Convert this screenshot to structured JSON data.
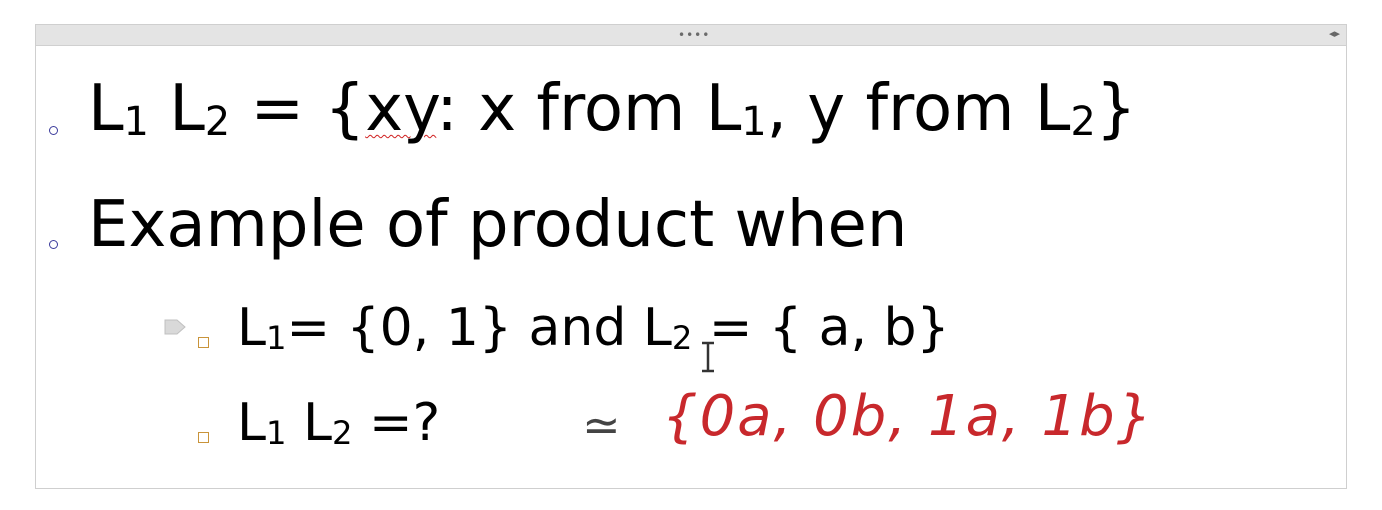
{
  "slide": {
    "grip": "••••",
    "nav": "◂▸",
    "bullets": [
      {
        "level": 1,
        "parts": {
          "a": "L",
          "a_sub": "1",
          "b": " L",
          "b_sub": "2",
          "eq": " = {",
          "xy": "xy",
          "rest": ": x from L",
          "r_sub": "1",
          "rest2": ", y from L",
          "r2_sub": "2",
          "close": "}"
        }
      },
      {
        "level": 1,
        "text": "Example of product when"
      },
      {
        "level": 2,
        "parts": {
          "a": "L",
          "a_sub": "1",
          "mid": "= {0, 1} and L",
          "m_sub": "2",
          "end": " = { a, b}"
        }
      },
      {
        "level": 2,
        "parts": {
          "a": "L",
          "a_sub": "1",
          "b": " L",
          "b_sub": "2",
          "end": " =?"
        }
      }
    ],
    "handwriting": {
      "approx": "≃",
      "answer": "{0a, 0b, 1a, 1b}",
      "color": "#c8282c"
    }
  }
}
